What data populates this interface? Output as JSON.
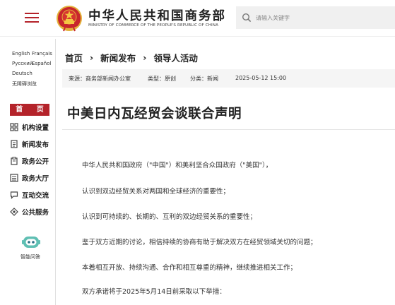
{
  "header": {
    "title": "中华人民共和国商务部",
    "subtitle": "MINISTRY OF COMMERCE OF THE PEOPLE'S REPUBLIC OF CHINA",
    "search_placeholder": "请输入关键字"
  },
  "languages": [
    "English",
    "Français",
    "Русский",
    "Español",
    "Deutsch",
    "无障碍浏览"
  ],
  "nav": {
    "home": "首 页",
    "items": [
      "机构设置",
      "新闻发布",
      "政务公开",
      "政务大厅",
      "互动交流",
      "公共服务"
    ]
  },
  "assistant": {
    "label": "智能问答"
  },
  "breadcrumb": [
    "首页",
    "新闻发布",
    "领导人活动"
  ],
  "meta": {
    "source": "来源：商务部新闻办公室",
    "type": "类型：原创",
    "category": "分类：新闻",
    "datetime": "2025-05-12 15:00"
  },
  "article": {
    "title": "中美日内瓦经贸会谈联合声明",
    "paragraphs": [
      "中华人民共和国政府（\"中国\"）和美利坚合众国政府（\"美国\"），",
      "认识到双边经贸关系对两国和全球经济的重要性；",
      "认识到可持续的、长期的、互利的双边经贸关系的重要性；",
      "鉴于双方近期的讨论，相信持续的协商有助于解决双方在经贸领域关切的问题；",
      "本着相互开放、持续沟通、合作和相互尊重的精神，继续推进相关工作；",
      "双方承诺将于2025年5月14日前采取以下举措："
    ]
  },
  "colors": {
    "accent": "#b4232a",
    "emblem_gold": "#e3b13a"
  }
}
